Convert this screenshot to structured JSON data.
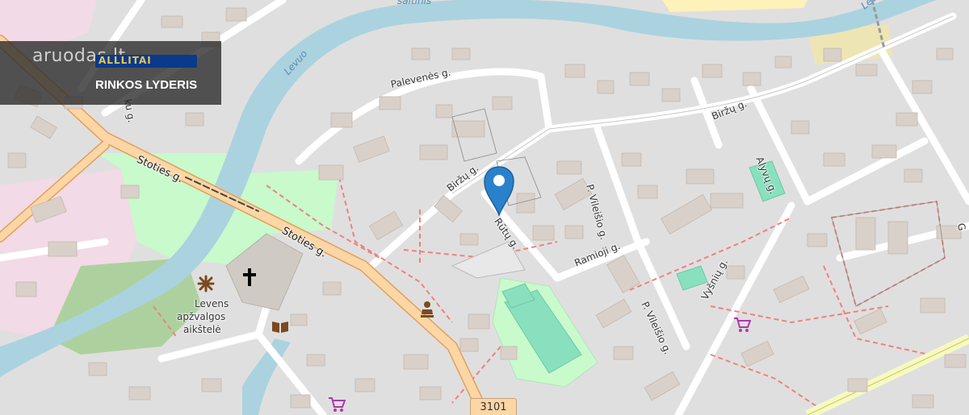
{
  "watermark": {
    "brand": "aruodas.lt",
    "partner": "ALLLITAI",
    "tagline": "RINKOS LYDERIS"
  },
  "streets": {
    "saltinis": "šaltinis",
    "levuo_top": "Levuo",
    "levuo_river": "Levuo",
    "palevenes": "Palevenės g.",
    "birzu_upper": "Biržų g.",
    "birzu_lower": "Biržų g.",
    "stoties_1": "Stoties g.",
    "stoties_2": "Stoties g.",
    "rutu": "Rūtų g.",
    "vileisio_1": "P. Vileišio g.",
    "vileisio_2": "P. Vileišio g.",
    "ramioji": "Ramioji g.",
    "alyvu": "Alyvų g.",
    "vytenu": "Vyšnių g.",
    "ku_partial": "ku g.",
    "g_partial": "G"
  },
  "place": {
    "name_line1": "Levens",
    "name_line2": "apžvalgos",
    "name_line3": "aikštelė"
  },
  "road_number": "3101",
  "poi_icons": [
    "marker-pin-icon",
    "church-icon",
    "viewpoint-icon",
    "library-icon",
    "monument-icon",
    "shop-icon",
    "shop-icon-2"
  ],
  "colors": {
    "water": "#aad3df",
    "road_primary": "#fcd6a4",
    "road_primary_edge": "#e2a05b",
    "park": "#c8facc",
    "pitch": "#88e0be",
    "landuse_pink": "#f2dae6",
    "marker": "#2a81cb"
  }
}
